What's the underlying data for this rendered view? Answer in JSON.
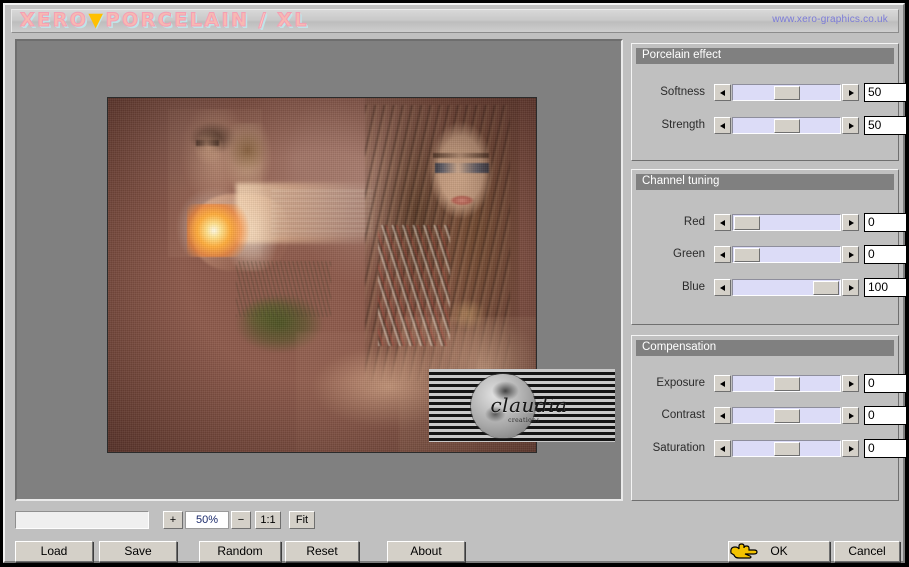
{
  "window": {
    "brand_prefix": "XERO",
    "brand_mark": "▼",
    "brand_mid": "PORCELAIN",
    "brand_slash": "/",
    "brand_suffix": "XL",
    "url": "www.xero-graphics.co.uk"
  },
  "preview": {
    "watermark_name": "claudia",
    "watermark_sub": "creations"
  },
  "zoom": {
    "plus_label": "+",
    "value": "50%",
    "minus_label": "−",
    "one_to_one_label": "1:1",
    "fit_label": "Fit"
  },
  "buttons": {
    "load": "Load",
    "save": "Save",
    "random": "Random",
    "reset": "Reset",
    "about": "About",
    "ok": "OK",
    "cancel": "Cancel"
  },
  "groups": [
    {
      "title": "Porcelain effect",
      "rows": [
        {
          "label": "Softness",
          "value": "50",
          "thumb_pct": 50
        },
        {
          "label": "Strength",
          "value": "50",
          "thumb_pct": 50
        }
      ]
    },
    {
      "title": "Channel tuning",
      "rows": [
        {
          "label": "Red",
          "value": "0",
          "thumb_pct": 0
        },
        {
          "label": "Green",
          "value": "0",
          "thumb_pct": 0
        },
        {
          "label": "Blue",
          "value": "100",
          "thumb_pct": 100
        }
      ]
    },
    {
      "title": "Compensation",
      "rows": [
        {
          "label": "Exposure",
          "value": "0",
          "thumb_pct": 50
        },
        {
          "label": "Contrast",
          "value": "0",
          "thumb_pct": 50
        },
        {
          "label": "Saturation",
          "value": "0",
          "thumb_pct": 50
        }
      ]
    }
  ],
  "colors": {
    "face": "#c0c0c0",
    "group_header": "#808080",
    "slider_track": "#dcdcf7",
    "canvas": "#808080",
    "url_text": "#7b7bd8",
    "zoom_value_text": "#1b2a6b",
    "cursor": "#f2c200"
  }
}
